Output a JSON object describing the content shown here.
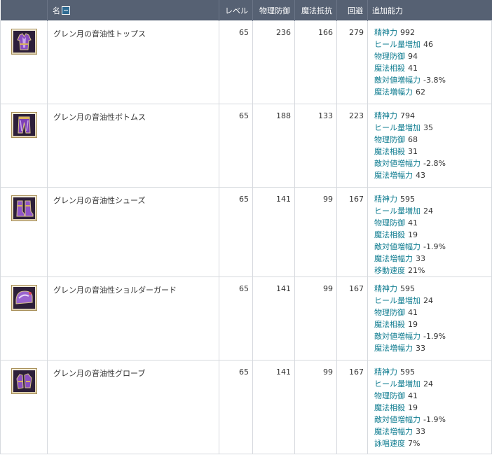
{
  "header": {
    "icon": "",
    "name": "名",
    "level": "レベル",
    "pdef": "物理防御",
    "mres": "魔法抵抗",
    "evade": "回避",
    "bonus": "追加能力"
  },
  "rows": [
    {
      "icon": "tops-armor-icon",
      "name": "グレン月の音油性トップス",
      "level": "65",
      "pdef": "236",
      "mres": "166",
      "evade": "279",
      "bonus": [
        {
          "label": "精神力",
          "value": "992"
        },
        {
          "label": "ヒール量増加",
          "value": "46"
        },
        {
          "label": "物理防御",
          "value": "94"
        },
        {
          "label": "魔法相殺",
          "value": "41"
        },
        {
          "label": "敵対値増幅力",
          "value": "-3.8%"
        },
        {
          "label": "魔法増幅力",
          "value": "62"
        }
      ]
    },
    {
      "icon": "bottoms-armor-icon",
      "name": "グレン月の音油性ボトムス",
      "level": "65",
      "pdef": "188",
      "mres": "133",
      "evade": "223",
      "bonus": [
        {
          "label": "精神力",
          "value": "794"
        },
        {
          "label": "ヒール量増加",
          "value": "35"
        },
        {
          "label": "物理防御",
          "value": "68"
        },
        {
          "label": "魔法相殺",
          "value": "31"
        },
        {
          "label": "敵対値増幅力",
          "value": "-2.8%"
        },
        {
          "label": "魔法増幅力",
          "value": "43"
        }
      ]
    },
    {
      "icon": "shoes-armor-icon",
      "name": "グレン月の音油性シューズ",
      "level": "65",
      "pdef": "141",
      "mres": "99",
      "evade": "167",
      "bonus": [
        {
          "label": "精神力",
          "value": "595"
        },
        {
          "label": "ヒール量増加",
          "value": "24"
        },
        {
          "label": "物理防御",
          "value": "41"
        },
        {
          "label": "魔法相殺",
          "value": "19"
        },
        {
          "label": "敵対値増幅力",
          "value": "-1.9%"
        },
        {
          "label": "魔法増幅力",
          "value": "33"
        },
        {
          "label": "移動速度",
          "value": "21%"
        }
      ]
    },
    {
      "icon": "shoulder-armor-icon",
      "name": "グレン月の音油性ショルダーガード",
      "level": "65",
      "pdef": "141",
      "mres": "99",
      "evade": "167",
      "bonus": [
        {
          "label": "精神力",
          "value": "595"
        },
        {
          "label": "ヒール量増加",
          "value": "24"
        },
        {
          "label": "物理防御",
          "value": "41"
        },
        {
          "label": "魔法相殺",
          "value": "19"
        },
        {
          "label": "敵対値増幅力",
          "value": "-1.9%"
        },
        {
          "label": "魔法増幅力",
          "value": "33"
        }
      ]
    },
    {
      "icon": "gloves-armor-icon",
      "name": "グレン月の音油性グローブ",
      "level": "65",
      "pdef": "141",
      "mres": "99",
      "evade": "167",
      "bonus": [
        {
          "label": "精神力",
          "value": "595"
        },
        {
          "label": "ヒール量増加",
          "value": "24"
        },
        {
          "label": "物理防御",
          "value": "41"
        },
        {
          "label": "魔法相殺",
          "value": "19"
        },
        {
          "label": "敵対値増幅力",
          "value": "-1.9%"
        },
        {
          "label": "魔法増幅力",
          "value": "33"
        },
        {
          "label": "詠唱速度",
          "value": "7%"
        }
      ]
    }
  ],
  "colors": {
    "header_bg": "#566173",
    "item_name": "#e05a14",
    "bonus_label": "#0f7c90"
  }
}
